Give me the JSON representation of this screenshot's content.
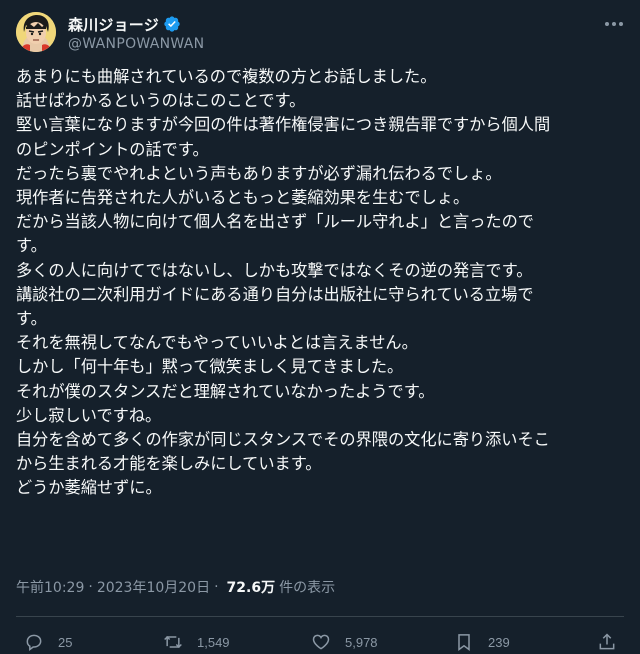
{
  "author": {
    "display_name": "森川ジョージ",
    "handle": "@WANPOWANWAN",
    "verified_color": "#1d9bf0"
  },
  "tweet": {
    "lines": [
      "あまりにも曲解されているので複数の方とお話しました。",
      "話せばわかるというのはこのことです。",
      "堅い言葉になりますが今回の件は著作権侵害につき親告罪ですから個人間",
      "のピンポイントの話です。",
      "だったら裏でやれよという声もありますが必ず漏れ伝わるでしょ。",
      "現作者に告発された人がいるともっと萎縮効果を生むでしょ。",
      "だから当該人物に向けて個人名を出さず「ルール守れよ」と言ったので",
      "す。",
      "多くの人に向けてではないし、しかも攻撃ではなくその逆の発言です。",
      "講談社の二次利用ガイドにある通り自分は出版社に守られている立場で",
      "す。",
      "それを無視してなんでもやっていいよとは言えません。",
      "しかし「何十年も」黙って微笑ましく見てきました。",
      "それが僕のスタンスだと理解されていなかったようです。",
      "少し寂しいですね。",
      "自分を含めて多くの作家が同じスタンスでその界隈の文化に寄り添いそこ",
      "から生まれる才能を楽しみにしています。",
      "どうか萎縮せずに。"
    ]
  },
  "meta": {
    "time": "午前10:29",
    "separator": "·",
    "date": "2023年10月20日",
    "views_count": "72.6万",
    "views_label": "件の表示"
  },
  "actions": {
    "replies": "25",
    "reposts": "1,549",
    "likes": "5,978",
    "bookmarks": "239"
  },
  "colors": {
    "background": "#15202b",
    "text": "#f7f9f9",
    "secondary": "#8b98a5",
    "divider": "#38444d"
  }
}
